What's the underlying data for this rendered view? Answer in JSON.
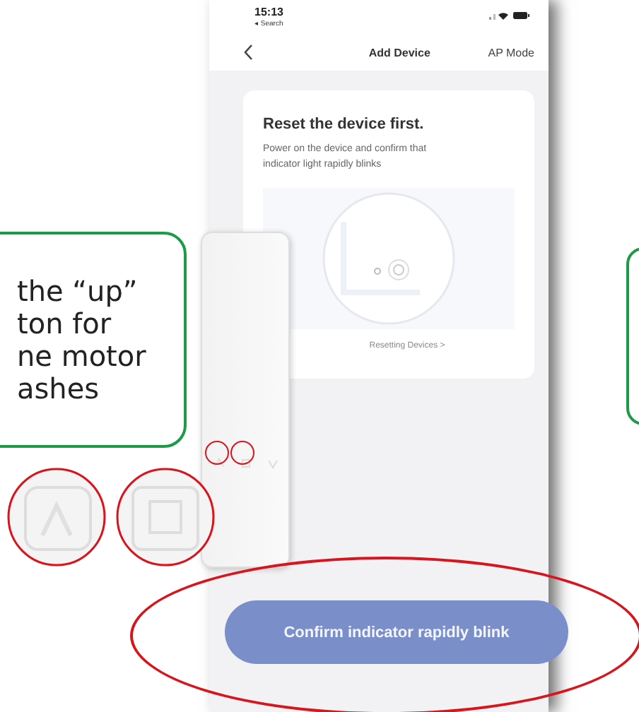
{
  "phone": {
    "status_bar": {
      "time": "15:13",
      "back_app": "◂ Search"
    },
    "nav": {
      "title": "Add Device",
      "action": "AP Mode"
    },
    "card": {
      "title": "Reset the device first.",
      "description": "Power on the device and confirm that indicator light rapidly blinks",
      "link": "Resetting Devices >"
    },
    "confirm_button": {
      "label": "Confirm indicator rapidly blink"
    }
  },
  "callout": {
    "lines": [
      "the “up”",
      "ton for",
      "ne motor",
      "ashes"
    ]
  }
}
